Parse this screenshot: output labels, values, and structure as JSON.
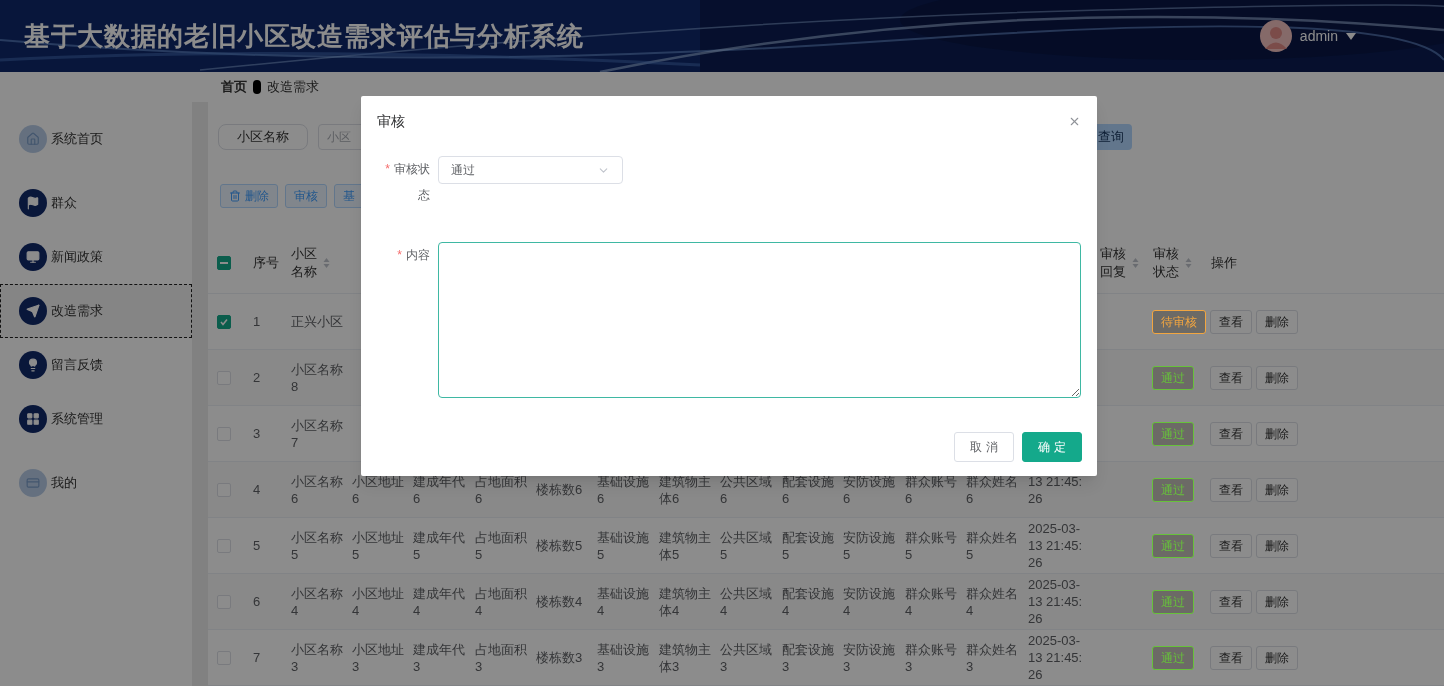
{
  "header": {
    "title": "基于大数据的老旧小区改造需求评估与分析系统",
    "user": "admin"
  },
  "breadcrumb": [
    "首页",
    "改造需求"
  ],
  "sidebar": {
    "items": [
      {
        "label": "系统首页",
        "selected": false
      },
      {
        "label": "群众",
        "selected": false
      },
      {
        "label": "新闻政策",
        "selected": false
      },
      {
        "label": "改造需求",
        "selected": true
      },
      {
        "label": "留言反馈",
        "selected": false
      },
      {
        "label": "系统管理",
        "selected": false
      },
      {
        "label": "我的",
        "selected": false
      }
    ]
  },
  "search": {
    "label": "小区名称",
    "placeholder": "小区",
    "button": "查询"
  },
  "toolbar": [
    {
      "label": "删除",
      "kind": "delete"
    },
    {
      "label": "审核",
      "kind": "plain"
    },
    {
      "label": "基",
      "kind": "plain"
    }
  ],
  "table": {
    "indeterminate": true,
    "columns": [
      {
        "label": "序号",
        "sortable": false
      },
      {
        "label": "小区名称",
        "sortable": true
      },
      null,
      null,
      null,
      null,
      null,
      null,
      null,
      null,
      null,
      null,
      null,
      null,
      {
        "label": "审核回复",
        "sortable": true
      },
      {
        "label": "审核状态",
        "sortable": true
      },
      {
        "label": "操作",
        "sortable": false
      }
    ],
    "rows": [
      {
        "checked": true,
        "cells": [
          "1",
          "正兴小区",
          null,
          null,
          null,
          null,
          null,
          null,
          null,
          null,
          null,
          null,
          null,
          null,
          null
        ],
        "status": {
          "text": "待审核",
          "color": "#f2a640"
        },
        "actions": [
          "查看",
          "删除"
        ]
      },
      {
        "checked": false,
        "cells": [
          "2",
          "小区名称8",
          null,
          null,
          null,
          null,
          null,
          null,
          null,
          null,
          null,
          null,
          null,
          null,
          null
        ],
        "status": {
          "text": "通过",
          "color": "#67c23a"
        },
        "actions": [
          "查看",
          "删除"
        ]
      },
      {
        "checked": false,
        "cells": [
          "3",
          "小区名称7",
          null,
          null,
          null,
          null,
          null,
          null,
          null,
          null,
          null,
          null,
          null,
          null,
          null
        ],
        "status": {
          "text": "通过",
          "color": "#67c23a"
        },
        "actions": [
          "查看",
          "删除"
        ]
      },
      {
        "checked": false,
        "cells": [
          "4",
          "小区名称6",
          "小区地址6",
          "建成年代6",
          "占地面积6",
          "楼栋数6",
          "基础设施6",
          "建筑物主体6",
          "公共区域6",
          "配套设施6",
          "安防设施6",
          "群众账号6",
          "群众姓名6",
          "13 21:45:26",
          null
        ],
        "status": {
          "text": "通过",
          "color": "#67c23a"
        },
        "actions": [
          "查看",
          "删除"
        ]
      },
      {
        "checked": false,
        "cells": [
          "5",
          "小区名称5",
          "小区地址5",
          "建成年代5",
          "占地面积5",
          "楼栋数5",
          "基础设施5",
          "建筑物主体5",
          "公共区域5",
          "配套设施5",
          "安防设施5",
          "群众账号5",
          "群众姓名5",
          "2025-03-13 21:45:26",
          null
        ],
        "status": {
          "text": "通过",
          "color": "#67c23a"
        },
        "actions": [
          "查看",
          "删除"
        ]
      },
      {
        "checked": false,
        "cells": [
          "6",
          "小区名称4",
          "小区地址4",
          "建成年代4",
          "占地面积4",
          "楼栋数4",
          "基础设施4",
          "建筑物主体4",
          "公共区域4",
          "配套设施4",
          "安防设施4",
          "群众账号4",
          "群众姓名4",
          "2025-03-13 21:45:26",
          null
        ],
        "status": {
          "text": "通过",
          "color": "#67c23a"
        },
        "actions": [
          "查看",
          "删除"
        ]
      },
      {
        "checked": false,
        "cells": [
          "7",
          "小区名称3",
          "小区地址3",
          "建成年代3",
          "占地面积3",
          "楼栋数3",
          "基础设施3",
          "建筑物主体3",
          "公共区域3",
          "配套设施3",
          "安防设施3",
          "群众账号3",
          "群众姓名3",
          "2025-03-13 21:45:26",
          null
        ],
        "status": {
          "text": "通过",
          "color": "#67c23a"
        },
        "actions": [
          "查看",
          "删除"
        ]
      }
    ]
  },
  "modal": {
    "title": "审核",
    "fields": [
      {
        "kind": "select",
        "mark": "*",
        "label": "审核状态",
        "value": "通过"
      },
      {
        "kind": "textarea",
        "mark": "*",
        "label": "内容",
        "focused": true
      }
    ],
    "buttons": [
      {
        "label": "取 消",
        "primary": false
      },
      {
        "label": "确 定",
        "primary": true
      }
    ]
  }
}
